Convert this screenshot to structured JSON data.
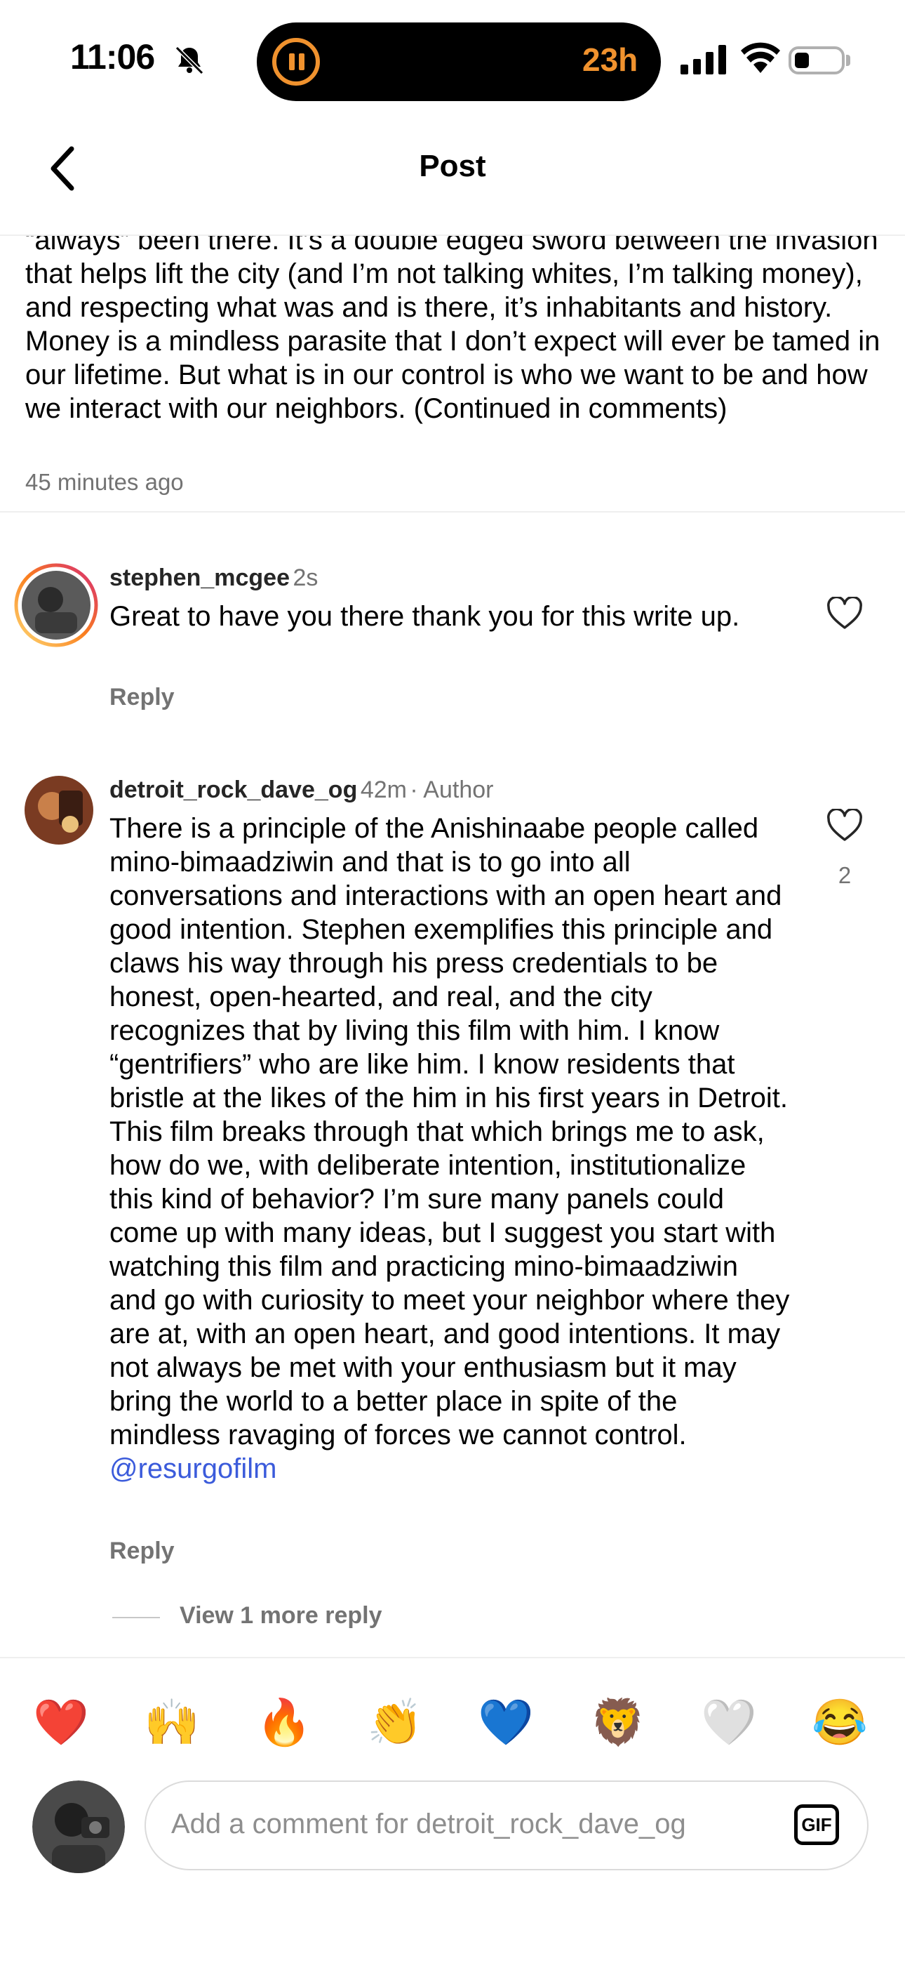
{
  "status_bar": {
    "time": "11:06",
    "timer": "23h"
  },
  "header": {
    "title": "Post"
  },
  "caption": {
    "text": "“always” been there. It’s a double edged sword between the invasion that helps lift the city (and I’m not talking whites, I’m talking money), and respecting what was and is there, it’s inhabitants and history. Money is a mindless parasite that I don’t expect will ever be tamed in our lifetime. But what is in our control is who we want to be and how we interact with our neighbors. (Continued in comments)",
    "time_ago": "45 minutes ago"
  },
  "comments": [
    {
      "username": "stephen_mcgee",
      "time": "2s",
      "author_badge": "",
      "text": "Great to have you there thank you for this write up.",
      "reply": "Reply",
      "likes": ""
    },
    {
      "username": "detroit_rock_dave_og",
      "time": "42m",
      "author_badge": "· Author",
      "text": "There is a principle of the Anishinaabe people called mino-bimaadziwin and that is to go into all conversations and interactions with an open heart and good intention. Stephen exemplifies this principle and claws his way through his press credentials to be honest, open-hearted, and real, and the city recognizes that by living this film with him. I know “gentrifiers” who are like him. I know residents that bristle at the likes of the him in his first years in Detroit. This film breaks through that which brings me to ask, how do we, with deliberate intention, institutionalize this kind of behavior? I’m sure many panels could come up with many ideas, but I suggest you start with watching this film and practicing mino-bimaadziwin and go with curiosity to meet your neighbor where they are at, with an open heart, and good intentions. It may not always be met with your enthusiasm but it may bring the world to a better place in spite of the mindless ravaging of forces we cannot control.",
      "mention": "@resurgofilm",
      "reply": "Reply",
      "likes": "2"
    }
  ],
  "view_more": "View 1 more reply",
  "emojis": [
    "❤️",
    "🙌",
    "🔥",
    "👏",
    "💙",
    "🦁",
    "🤍",
    "😂"
  ],
  "input": {
    "placeholder": "Add a comment for detroit_rock_dave_og",
    "gif_label": "GIF"
  },
  "colors": {
    "accent_timer": "#f0922e",
    "mention": "#3b5bdb",
    "secondary_text": "#737373"
  }
}
